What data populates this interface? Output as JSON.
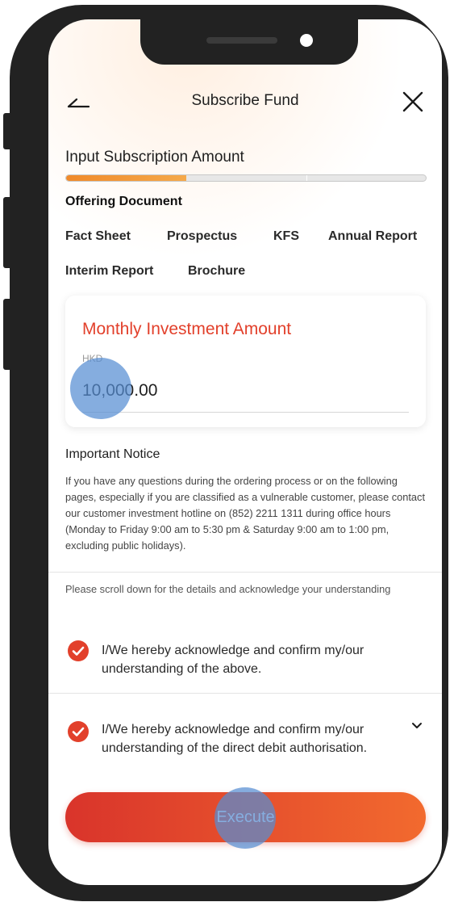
{
  "header": {
    "back_icon": "back-arrow-icon",
    "title": "Subscribe Fund",
    "close_icon": "close-icon"
  },
  "progress": {
    "step_label": "Input Subscription Amount",
    "fraction": 0.335,
    "accent": "#f08a2a"
  },
  "offering": {
    "title": "Offering Document",
    "links": [
      "Fact Sheet",
      "Prospectus",
      "KFS",
      "Annual Report",
      "Interim Report",
      "Brochure"
    ]
  },
  "amount": {
    "label": "Monthly Investment Amount",
    "currency": "HKD",
    "value": "10,000.00",
    "label_color": "#e2402b"
  },
  "notice": {
    "title": "Important Notice",
    "body": "If you have any questions during the ordering process or on the following pages, especially if you are classified as a vulnerable customer, please contact our customer investment hotline on (852) 2211 1311 during office hours (Monday to Friday 9:00 am to 5:30 pm & Saturday 9:00 am to 1:00 pm, excluding public holidays).",
    "scroll_hint": "Please scroll down for the details and acknowledge your understanding"
  },
  "acknowledgements": [
    {
      "text": "I/We hereby acknowledge and confirm my/our understanding of the above.",
      "checked": true
    },
    {
      "text": "I/We hereby acknowledge and confirm my/our understanding of the direct debit authorisation.",
      "checked": true,
      "icon": "chevron-down-icon"
    }
  ],
  "execute": {
    "label": "Execute",
    "gradient_start": "#d9342b",
    "gradient_end": "#f26a2e"
  },
  "check_color": "#e2402b"
}
